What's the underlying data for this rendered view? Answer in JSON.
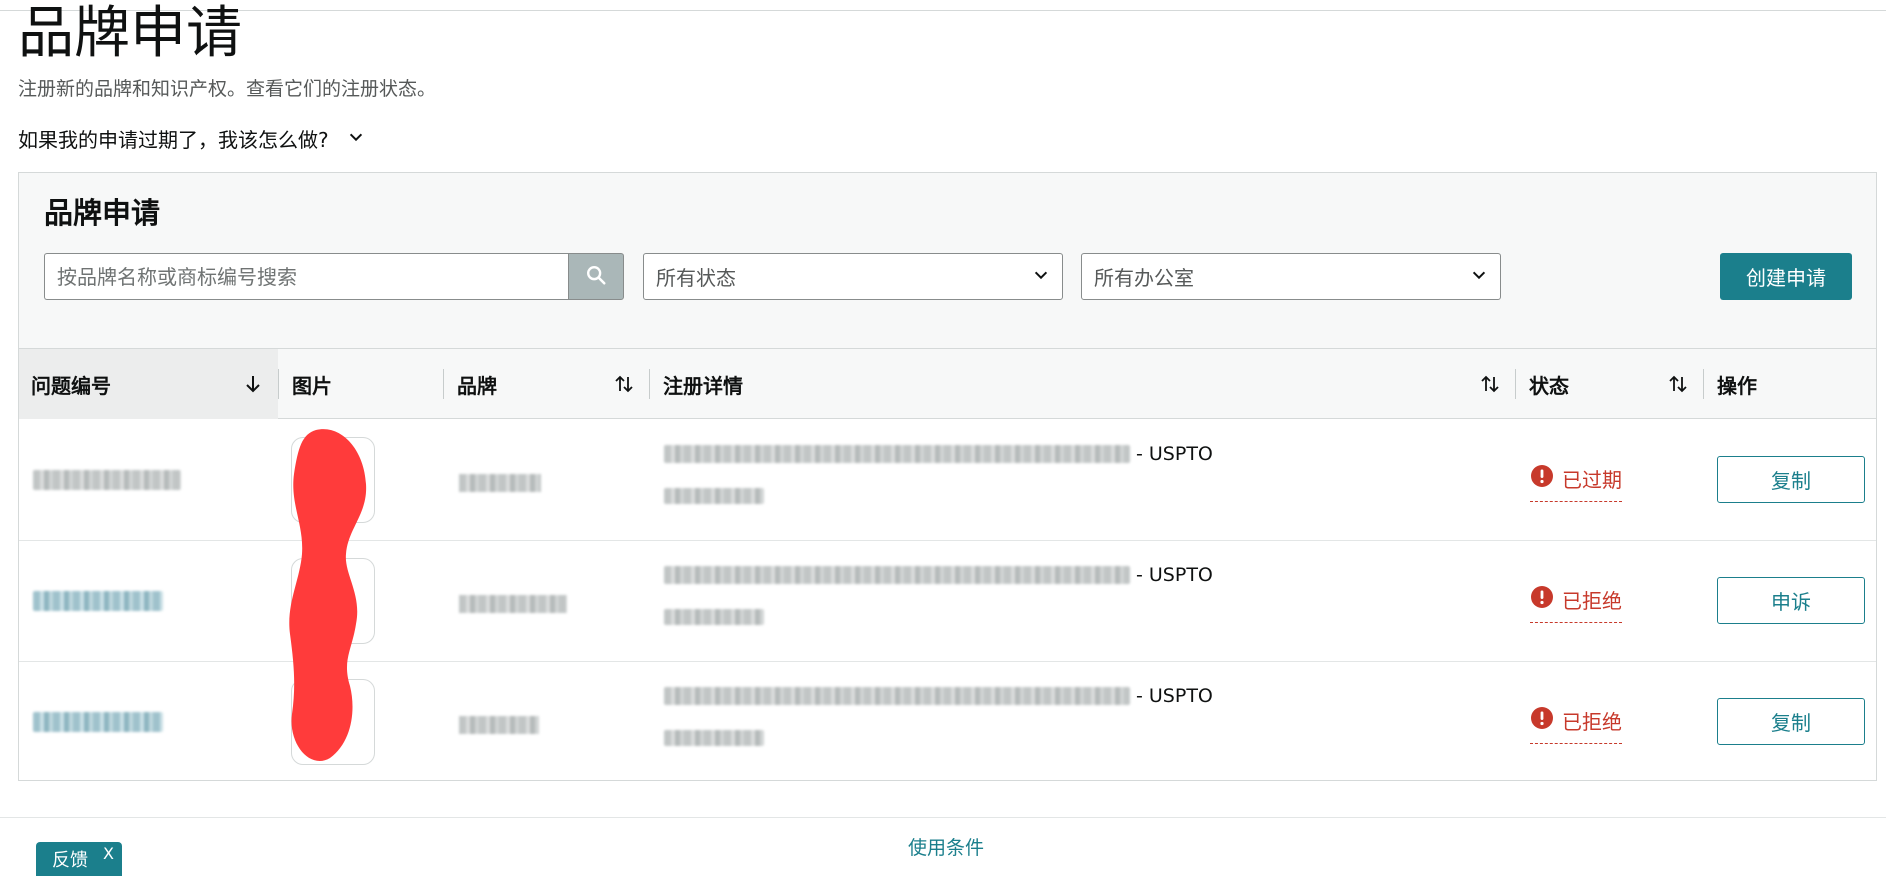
{
  "page": {
    "title": "品牌申请",
    "subtitle": "注册新的品牌和知识产权。查看它们的注册状态。",
    "faq_question": "如果我的申请过期了，我该怎么做?"
  },
  "panel": {
    "title": "品牌申请",
    "search_placeholder": "按品牌名称或商标编号搜索",
    "status_filter": "所有状态",
    "office_filter": "所有办公室",
    "create_button": "创建申请"
  },
  "table": {
    "columns": {
      "id": "问题编号",
      "image": "图片",
      "brand": "品牌",
      "details": "注册详情",
      "status": "状态",
      "action": "操作"
    },
    "rows": [
      {
        "office_suffix": "- USPTO",
        "status": "已过期",
        "action": "复制"
      },
      {
        "office_suffix": "- USPTO",
        "status": "已拒绝",
        "action": "申诉"
      },
      {
        "office_suffix": "- USPTO",
        "status": "已拒绝",
        "action": "复制"
      }
    ]
  },
  "footer": {
    "terms": "使用条件",
    "feedback": "反馈",
    "feedback_close": "X"
  },
  "colors": {
    "accent": "#1b7f8c",
    "error": "#c7392b",
    "scribble": "#ff3b3b"
  },
  "icons": [
    "chevron-down-icon",
    "search-icon",
    "sort-down-icon",
    "sort-both-icon",
    "error-icon"
  ]
}
